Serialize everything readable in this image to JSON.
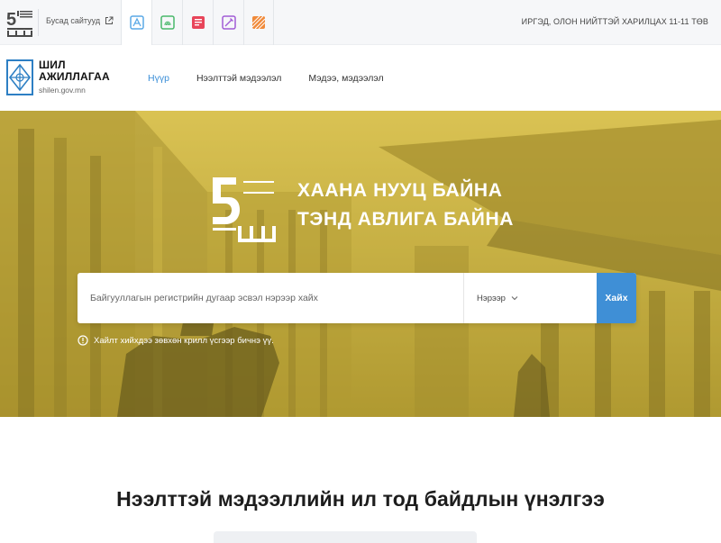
{
  "topbar": {
    "other_sites_label": "Бусад сайтууд",
    "hotline": "ИРГЭД, ОЛОН НИЙТТЭЙ ХАРИЛЦАХ 11-11 ТӨВ",
    "site_tiles": [
      {
        "icon": "glass-frame-icon",
        "color": "#5aa9e6",
        "active": true
      },
      {
        "icon": "fingerprint-icon",
        "color": "#49b86a",
        "active": false
      },
      {
        "icon": "document-icon",
        "color": "#e8455a",
        "active": false
      },
      {
        "icon": "pen-icon",
        "color": "#a15bd6",
        "active": false
      },
      {
        "icon": "diagonal-grid-icon",
        "color": "#f08a3a",
        "active": false
      }
    ]
  },
  "header": {
    "brand_line1": "ШИЛ",
    "brand_line2": "АЖИЛЛАГАА",
    "brand_url": "shilen.gov.mn",
    "nav": [
      {
        "label": "Нүүр",
        "active": true
      },
      {
        "label": "Нээлттэй мэдээлэл",
        "active": false
      },
      {
        "label": "Мэдээ, мэдээлэл",
        "active": false
      }
    ],
    "accent_color": "#3c8fd8"
  },
  "hero": {
    "slogan_line1": "ХААНА НУУЦ БАЙНА",
    "slogan_line2": "ТЭНД АВЛИГА БАЙНА",
    "search_placeholder": "Байгууллагын регистрийн дугаар эсвэл нэрээр хайх",
    "search_value": "",
    "select_value": "Нэрээр",
    "search_button": "Хайх",
    "hint": "Хайлт хийхдээ зөвхөн крилл үсгээр бичнэ үү.",
    "overlay_color": "#d9bd3a"
  },
  "section": {
    "title": "Нээлттэй мэдээллийн ил тод байдлын үнэлгээ"
  }
}
